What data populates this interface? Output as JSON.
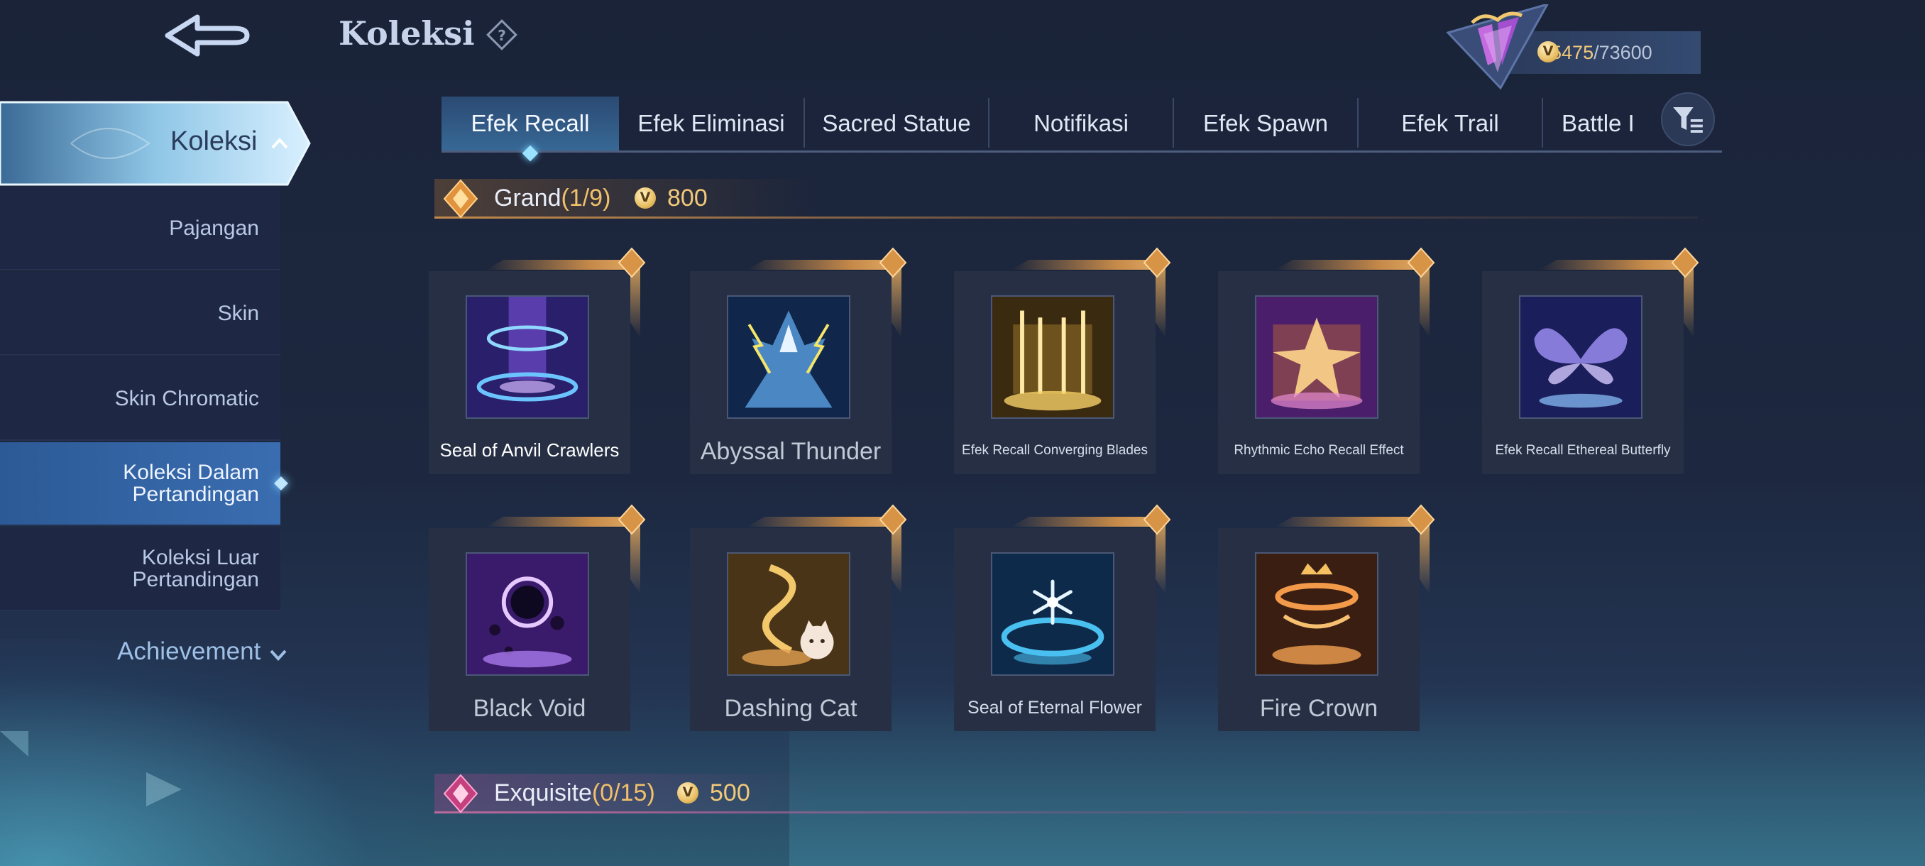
{
  "header": {
    "title": "Koleksi"
  },
  "currency": {
    "current": "65475",
    "separator": "/",
    "max": "73600"
  },
  "sidebar": {
    "active_group": "Koleksi",
    "items": [
      {
        "label": "Pajangan"
      },
      {
        "label": "Skin"
      },
      {
        "label": "Skin Chromatic"
      },
      {
        "label": "Koleksi Dalam Pertandingan"
      },
      {
        "label": "Koleksi Luar Pertandingan"
      }
    ],
    "achievement": "Achievement"
  },
  "tabs": [
    "Efek Recall",
    "Efek Eliminasi",
    "Sacred Statue",
    "Notifikasi",
    "Efek Spawn",
    "Efek Trail",
    "Battle I"
  ],
  "sections": {
    "grand": {
      "name": "Grand",
      "count": "(1/9)",
      "price": "800"
    },
    "exquisite": {
      "name": "Exquisite",
      "count": "(0/15)",
      "price": "500"
    }
  },
  "cards": [
    {
      "name": "Seal of Anvil Crawlers"
    },
    {
      "name": "Abyssal Thunder"
    },
    {
      "name": "Efek Recall Converging Blades"
    },
    {
      "name": "Rhythmic Echo Recall Effect"
    },
    {
      "name": "Efek Recall Ethereal Butterfly"
    },
    {
      "name": "Black Void"
    },
    {
      "name": "Dashing Cat"
    },
    {
      "name": "Seal of Eternal Flower"
    },
    {
      "name": "Fire Crown"
    }
  ],
  "colors": {
    "accent_gold": "#f2c97a",
    "active_tab": "#376895",
    "sidebar_selected": "#3a6db0"
  }
}
